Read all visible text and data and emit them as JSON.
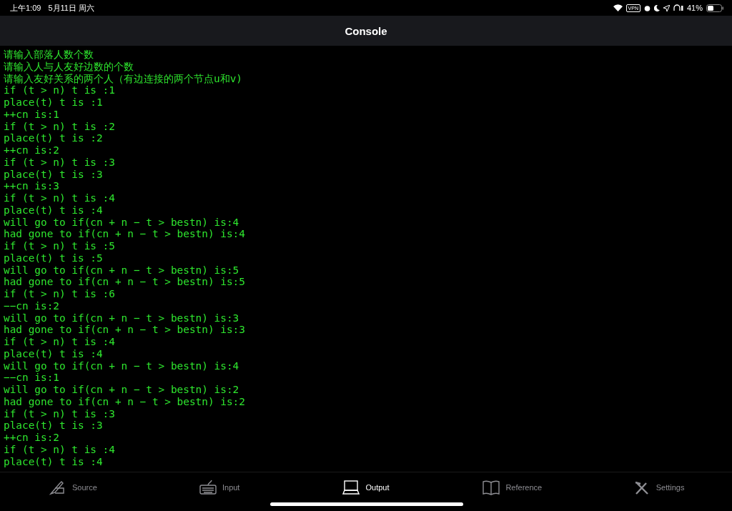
{
  "status_bar": {
    "time": "上午1:09",
    "date": "5月11日 周六",
    "vpn": "VPN",
    "battery": "41%"
  },
  "nav": {
    "title": "Console"
  },
  "console_lines": [
    "请输入部落人数个数",
    "请输入人与人友好边数的个数",
    "请输入友好关系的两个人（有边连接的两个节点u和v)",
    "if (t > n) t is :1",
    "place(t) t is :1",
    "++cn is:1",
    "if (t > n) t is :2",
    "place(t) t is :2",
    "++cn is:2",
    "if (t > n) t is :3",
    "place(t) t is :3",
    "++cn is:3",
    "if (t > n) t is :4",
    "place(t) t is :4",
    "will go to if(cn + n − t > bestn) is:4",
    "had gone to if(cn + n − t > bestn) is:4",
    "if (t > n) t is :5",
    "place(t) t is :5",
    "will go to if(cn + n − t > bestn) is:5",
    "had gone to if(cn + n − t > bestn) is:5",
    "if (t > n) t is :6",
    "−−cn is:2",
    "will go to if(cn + n − t > bestn) is:3",
    "had gone to if(cn + n − t > bestn) is:3",
    "if (t > n) t is :4",
    "place(t) t is :4",
    "will go to if(cn + n − t > bestn) is:4",
    "−−cn is:1",
    "will go to if(cn + n − t > bestn) is:2",
    "had gone to if(cn + n − t > bestn) is:2",
    "if (t > n) t is :3",
    "place(t) t is :3",
    "++cn is:2",
    "if (t > n) t is :4",
    "place(t) t is :4"
  ],
  "tabs": [
    {
      "kind": "source",
      "label": "Source",
      "selected": false
    },
    {
      "kind": "input",
      "label": "Input",
      "selected": false
    },
    {
      "kind": "output",
      "label": "Output",
      "selected": true
    },
    {
      "kind": "reference",
      "label": "Reference",
      "selected": false
    },
    {
      "kind": "settings",
      "label": "Settings",
      "selected": false
    }
  ]
}
